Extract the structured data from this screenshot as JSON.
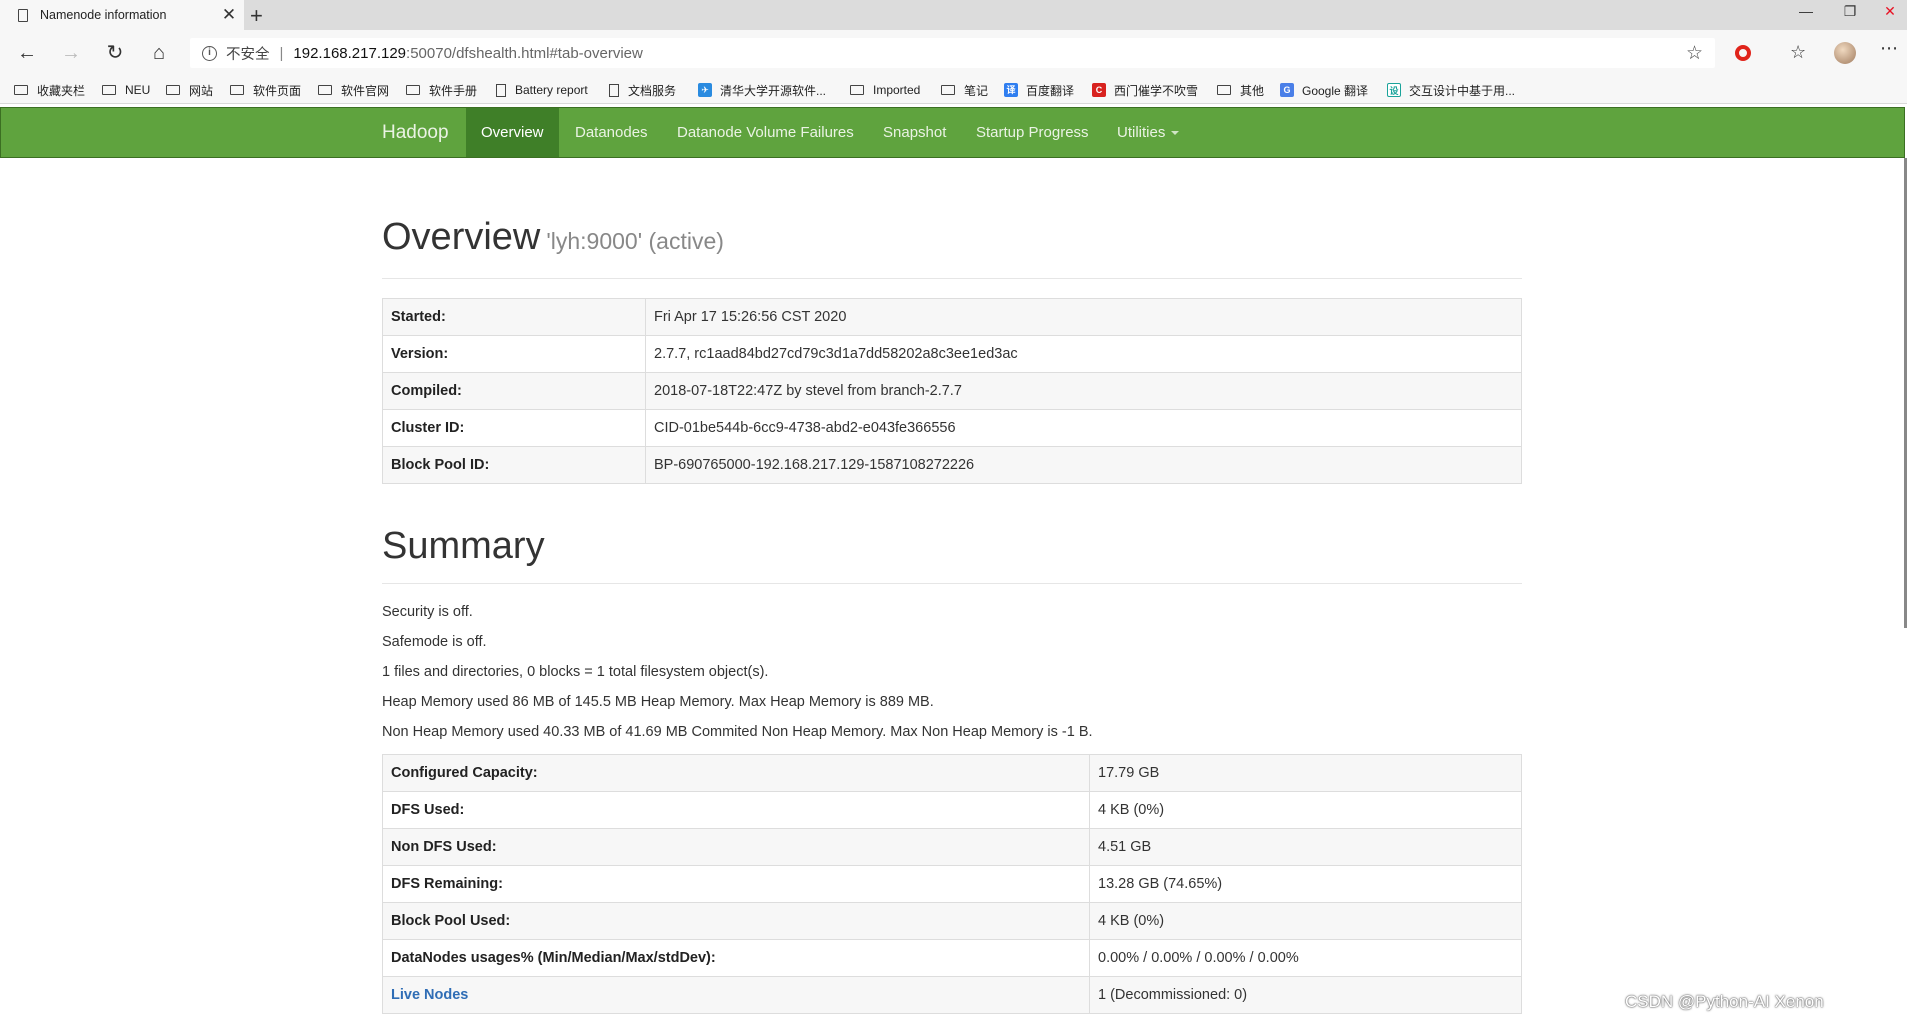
{
  "browser": {
    "tab_title": "Namenode information",
    "tab_close": "✕",
    "new_tab": "+",
    "window_controls": [
      "—",
      "❐",
      "✕"
    ],
    "insecure_label": "不安全",
    "url_host": "192.168.217.129",
    "url_rest": ":50070/dfshealth.html#tab-overview",
    "bookmarks": [
      {
        "icon": "folder-icon",
        "label": "收藏夹栏"
      },
      {
        "icon": "folder-icon",
        "label": "NEU"
      },
      {
        "icon": "folder-icon",
        "label": "网站"
      },
      {
        "icon": "folder-icon",
        "label": "软件页面"
      },
      {
        "icon": "folder-icon",
        "label": "软件官网"
      },
      {
        "icon": "folder-icon",
        "label": "软件手册"
      },
      {
        "icon": "document-icon",
        "label": "Battery report"
      },
      {
        "icon": "document-icon",
        "label": "文档服务"
      },
      {
        "icon": "tsinghua-icon",
        "label": "清华大学开源软件..."
      },
      {
        "icon": "folder-icon",
        "label": "Imported"
      },
      {
        "icon": "folder-icon",
        "label": "笔记"
      },
      {
        "icon": "baidu-translate-icon",
        "label": "百度翻译"
      },
      {
        "icon": "ximen-icon",
        "label": "西门催学不吹雪"
      },
      {
        "icon": "folder-icon",
        "label": "其他"
      },
      {
        "icon": "google-translate-icon",
        "label": "Google 翻译"
      },
      {
        "icon": "interaction-design-icon",
        "label": "交互设计中基于用..."
      }
    ]
  },
  "nav": {
    "brand": "Hadoop",
    "items": [
      {
        "label": "Overview"
      },
      {
        "label": "Datanodes"
      },
      {
        "label": "Datanode Volume Failures"
      },
      {
        "label": "Snapshot"
      },
      {
        "label": "Startup Progress"
      },
      {
        "label": "Utilities"
      }
    ]
  },
  "overview": {
    "title": "Overview",
    "subtitle": "'lyh:9000' (active)",
    "rows": [
      {
        "key": "Started:",
        "value": "Fri Apr 17 15:26:56 CST 2020"
      },
      {
        "key": "Version:",
        "value": "2.7.7, rc1aad84bd27cd79c3d1a7dd58202a8c3ee1ed3ac"
      },
      {
        "key": "Compiled:",
        "value": "2018-07-18T22:47Z by stevel from branch-2.7.7"
      },
      {
        "key": "Cluster ID:",
        "value": "CID-01be544b-6cc9-4738-abd2-e043fe366556"
      },
      {
        "key": "Block Pool ID:",
        "value": "BP-690765000-192.168.217.129-1587108272226"
      }
    ]
  },
  "summary": {
    "title": "Summary",
    "lines": [
      "Security is off.",
      "Safemode is off.",
      "1 files and directories, 0 blocks = 1 total filesystem object(s).",
      "Heap Memory used 86 MB of 145.5 MB Heap Memory. Max Heap Memory is 889 MB.",
      "Non Heap Memory used 40.33 MB of 41.69 MB Commited Non Heap Memory. Max Non Heap Memory is -1 B."
    ],
    "rows": [
      {
        "key": "Configured Capacity:",
        "value": "17.79 GB"
      },
      {
        "key": "DFS Used:",
        "value": "4 KB (0%)"
      },
      {
        "key": "Non DFS Used:",
        "value": "4.51 GB"
      },
      {
        "key": "DFS Remaining:",
        "value": "13.28 GB (74.65%)"
      },
      {
        "key": "Block Pool Used:",
        "value": "4 KB (0%)"
      },
      {
        "key": "DataNodes usages% (Min/Median/Max/stdDev):",
        "value": "0.00% / 0.00% / 0.00% / 0.00%"
      },
      {
        "key": "Live Nodes",
        "value": "1 (Decommissioned: 0)"
      }
    ]
  },
  "watermark": "CSDN @Python-AI Xenon"
}
